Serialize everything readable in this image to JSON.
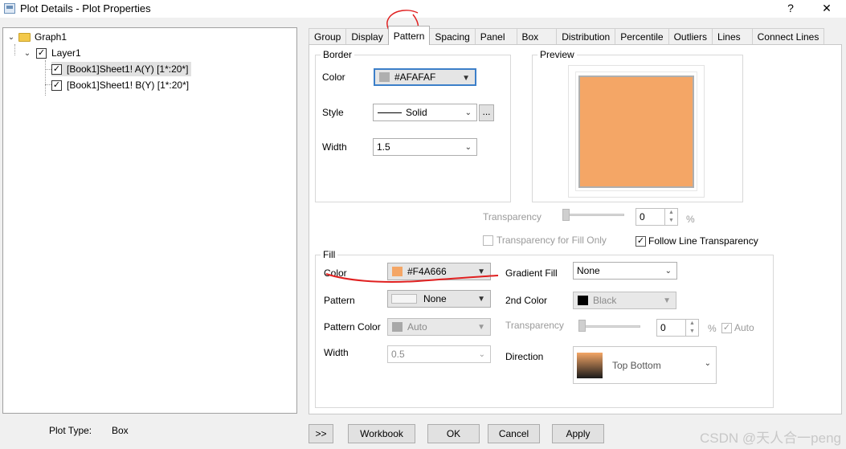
{
  "window": {
    "title": "Plot Details - Plot Properties",
    "help": "?",
    "close": "✕"
  },
  "tree": {
    "graph": "Graph1",
    "layer": "Layer1",
    "items": [
      "[Book1]Sheet1! A(Y) [1*:20*]",
      "[Book1]Sheet1! B(Y) [1*:20*]"
    ]
  },
  "tabs": [
    "Group",
    "Display",
    "Pattern",
    "Spacing",
    "Panel",
    "Box",
    "Distribution",
    "Percentile",
    "Outliers",
    "Lines",
    "Connect Lines"
  ],
  "active_tab": "Pattern",
  "border": {
    "legend": "Border",
    "color_label": "Color",
    "color_value": "#AFAFAF",
    "color_hex": "#AFAFAF",
    "style_label": "Style",
    "style_value": "Solid",
    "more": "...",
    "width_label": "Width",
    "width_value": "1.5"
  },
  "preview": {
    "legend": "Preview",
    "fill": "#F4A666",
    "border": "#AFAFAF"
  },
  "transparency": {
    "label": "Transparency",
    "value": "0",
    "unit": "%"
  },
  "fill_only": "Transparency for Fill Only",
  "follow_line": "Follow Line Transparency",
  "fill": {
    "legend": "Fill",
    "color_label": "Color",
    "color_value": "#F4A666",
    "color_hex": "#F4A666",
    "pattern_label": "Pattern",
    "pattern_value": "None",
    "pattern_color_label": "Pattern Color",
    "pattern_color_value": "Auto",
    "width_label": "Width",
    "width_value": "0.5",
    "gradient_label": "Gradient Fill",
    "gradient_value": "None",
    "second_color_label": "2nd Color",
    "second_color_value": "Black",
    "transparency_label": "Transparency",
    "transparency_value": "0",
    "transparency_unit": "%",
    "auto": "Auto",
    "direction_label": "Direction",
    "direction_value": "Top Bottom"
  },
  "footer": {
    "plot_type_label": "Plot Type:",
    "plot_type_value": "Box",
    "expand": ">>",
    "workbook": "Workbook",
    "ok": "OK",
    "cancel": "Cancel",
    "apply": "Apply"
  },
  "watermark": "CSDN @天人合一peng"
}
